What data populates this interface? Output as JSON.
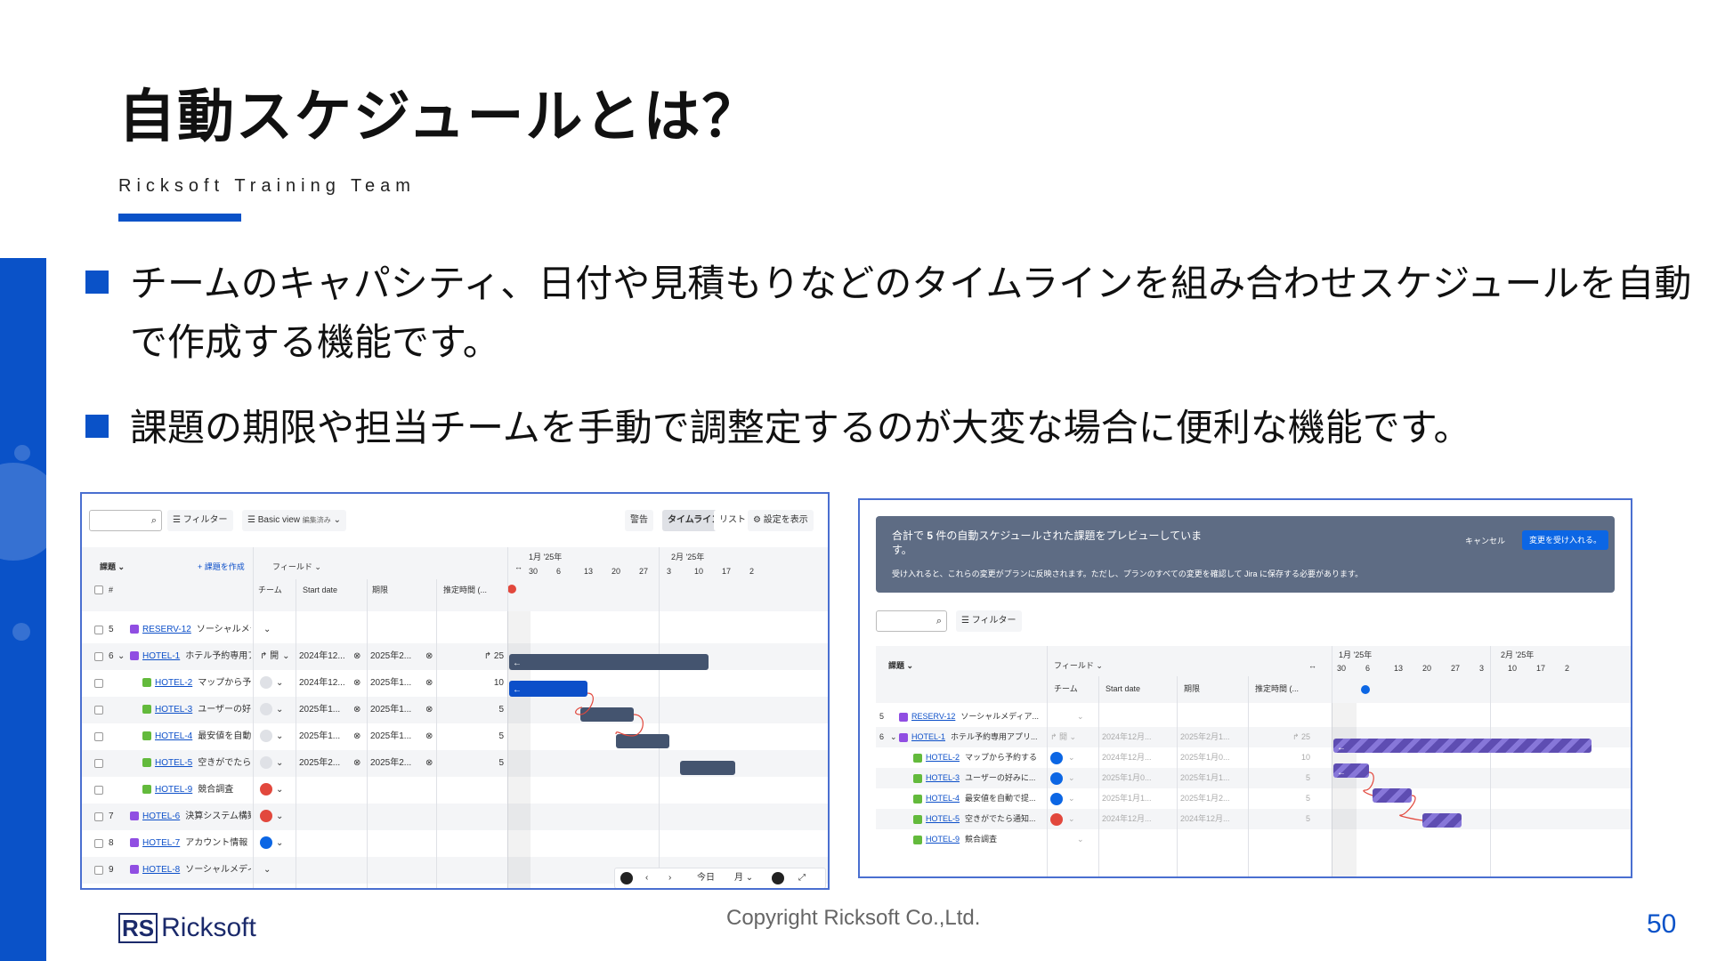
{
  "slide": {
    "title": "自動スケジュールとは？",
    "subtitle": "Ricksoft Training Team",
    "bullets": [
      "チームのキャパシティ、日付や見積もりなどのタイムラインを組み合わせスケジュールを自動で作成する機能です。",
      "課題の期限や担当チームを手動で調整定するのが大変な場合に便利な機能です。"
    ],
    "copyright": "Copyright Ricksoft Co.,Ltd.",
    "page_number": "50",
    "logo_mark": "RS",
    "logo_text": "Ricksoft",
    "accent_color": "#0a52c8"
  },
  "left_panel": {
    "toolbar": {
      "filter": "フィルター",
      "view": "Basic view",
      "view_badge": "編集済み",
      "warning": "警告",
      "timeline": "タイムライン",
      "list": "リスト",
      "settings": "設定を表示"
    },
    "header": {
      "issue": "課題",
      "create": "+ 課題を作成",
      "fields": "フィールド",
      "hash": "#",
      "team": "チーム",
      "start": "Start date",
      "due": "期限",
      "estimate": "推定時間 (...",
      "month1": "1月 '25年",
      "month2": "2月 '25年",
      "days": [
        "30",
        "6",
        "13",
        "20",
        "27",
        "3",
        "10",
        "17",
        "2"
      ]
    },
    "rows": [
      {
        "num": "5",
        "key": "RESERV-12",
        "title": "ソーシャルメディ...",
        "type": "epic",
        "team": "",
        "start": "",
        "due": "",
        "est": ""
      },
      {
        "num": "6",
        "key": "HOTEL-1",
        "title": "ホテル予約専用ア...",
        "type": "epic",
        "team": "開",
        "start": "2024年12...",
        "due": "2025年2...",
        "est": "25"
      },
      {
        "num": "",
        "key": "HOTEL-2",
        "title": "マップから予...",
        "type": "story",
        "team": "",
        "start": "2024年12...",
        "due": "2025年1...",
        "est": "10"
      },
      {
        "num": "",
        "key": "HOTEL-3",
        "title": "ユーザーの好...",
        "type": "story",
        "team": "",
        "start": "2025年1...",
        "due": "2025年1...",
        "est": "5"
      },
      {
        "num": "",
        "key": "HOTEL-4",
        "title": "最安値を自動...",
        "type": "story",
        "team": "",
        "start": "2025年1...",
        "due": "2025年1...",
        "est": "5"
      },
      {
        "num": "",
        "key": "HOTEL-5",
        "title": "空きがでたら...",
        "type": "story",
        "team": "",
        "start": "2025年2...",
        "due": "2025年2...",
        "est": "5"
      },
      {
        "num": "",
        "key": "HOTEL-9",
        "title": "競合調査",
        "type": "story",
        "team": "",
        "start": "",
        "due": "",
        "est": ""
      },
      {
        "num": "7",
        "key": "HOTEL-6",
        "title": "決算システム構築",
        "type": "epic",
        "team": "",
        "start": "",
        "due": "",
        "est": ""
      },
      {
        "num": "8",
        "key": "HOTEL-7",
        "title": "アカウント情報",
        "type": "epic",
        "team": "",
        "start": "",
        "due": "",
        "est": ""
      },
      {
        "num": "9",
        "key": "HOTEL-8",
        "title": "ソーシャルメディ...",
        "type": "epic",
        "team": "",
        "start": "",
        "due": "",
        "est": ""
      }
    ],
    "footer": {
      "today": "今日",
      "month": "月"
    }
  },
  "right_panel": {
    "banner": {
      "line1_prefix": "合計で ",
      "count": "5",
      "line1_suffix": " 件の自動スケジュールされた課題をプレビューしていま",
      "line1_wrap": "す。",
      "line2": "受け入れると、これらの変更がプランに反映されます。ただし、プランのすべての変更を確認して Jira に保存する必要があります。",
      "cancel": "キャンセル",
      "accept": "変更を受け入れる。"
    },
    "toolbar": {
      "filter": "フィルター"
    },
    "header": {
      "issue": "課題",
      "fields": "フィールド",
      "team": "チーム",
      "start": "Start date",
      "due": "期限",
      "estimate": "推定時間 (...",
      "month1": "1月 '25年",
      "month2": "2月 '25年",
      "days": [
        "30",
        "6",
        "13",
        "20",
        "27",
        "3",
        "10",
        "17",
        "2"
      ]
    },
    "rows": [
      {
        "num": "5",
        "key": "RESERV-12",
        "title": "ソーシャルメディア...",
        "type": "epic",
        "start": "",
        "due": "",
        "est": ""
      },
      {
        "num": "6",
        "key": "HOTEL-1",
        "title": "ホテル予約専用アプリ...",
        "type": "epic",
        "start": "2024年12月...",
        "due": "2025年2月1...",
        "est": "25"
      },
      {
        "num": "",
        "key": "HOTEL-2",
        "title": "マップから予約する",
        "type": "story",
        "start": "2024年12月...",
        "due": "2025年1月0...",
        "est": "10"
      },
      {
        "num": "",
        "key": "HOTEL-3",
        "title": "ユーザーの好みに...",
        "type": "story",
        "start": "2025年1月0...",
        "due": "2025年1月1...",
        "est": "5"
      },
      {
        "num": "",
        "key": "HOTEL-4",
        "title": "最安値を自動で提...",
        "type": "story",
        "start": "2025年1月1...",
        "due": "2025年1月2...",
        "est": "5"
      },
      {
        "num": "",
        "key": "HOTEL-5",
        "title": "空きがでたら通知...",
        "type": "story",
        "start": "2024年12月...",
        "due": "2024年12月...",
        "est": "5"
      },
      {
        "num": "",
        "key": "HOTEL-9",
        "title": "競合調査",
        "type": "story",
        "start": "",
        "due": "",
        "est": ""
      }
    ]
  }
}
